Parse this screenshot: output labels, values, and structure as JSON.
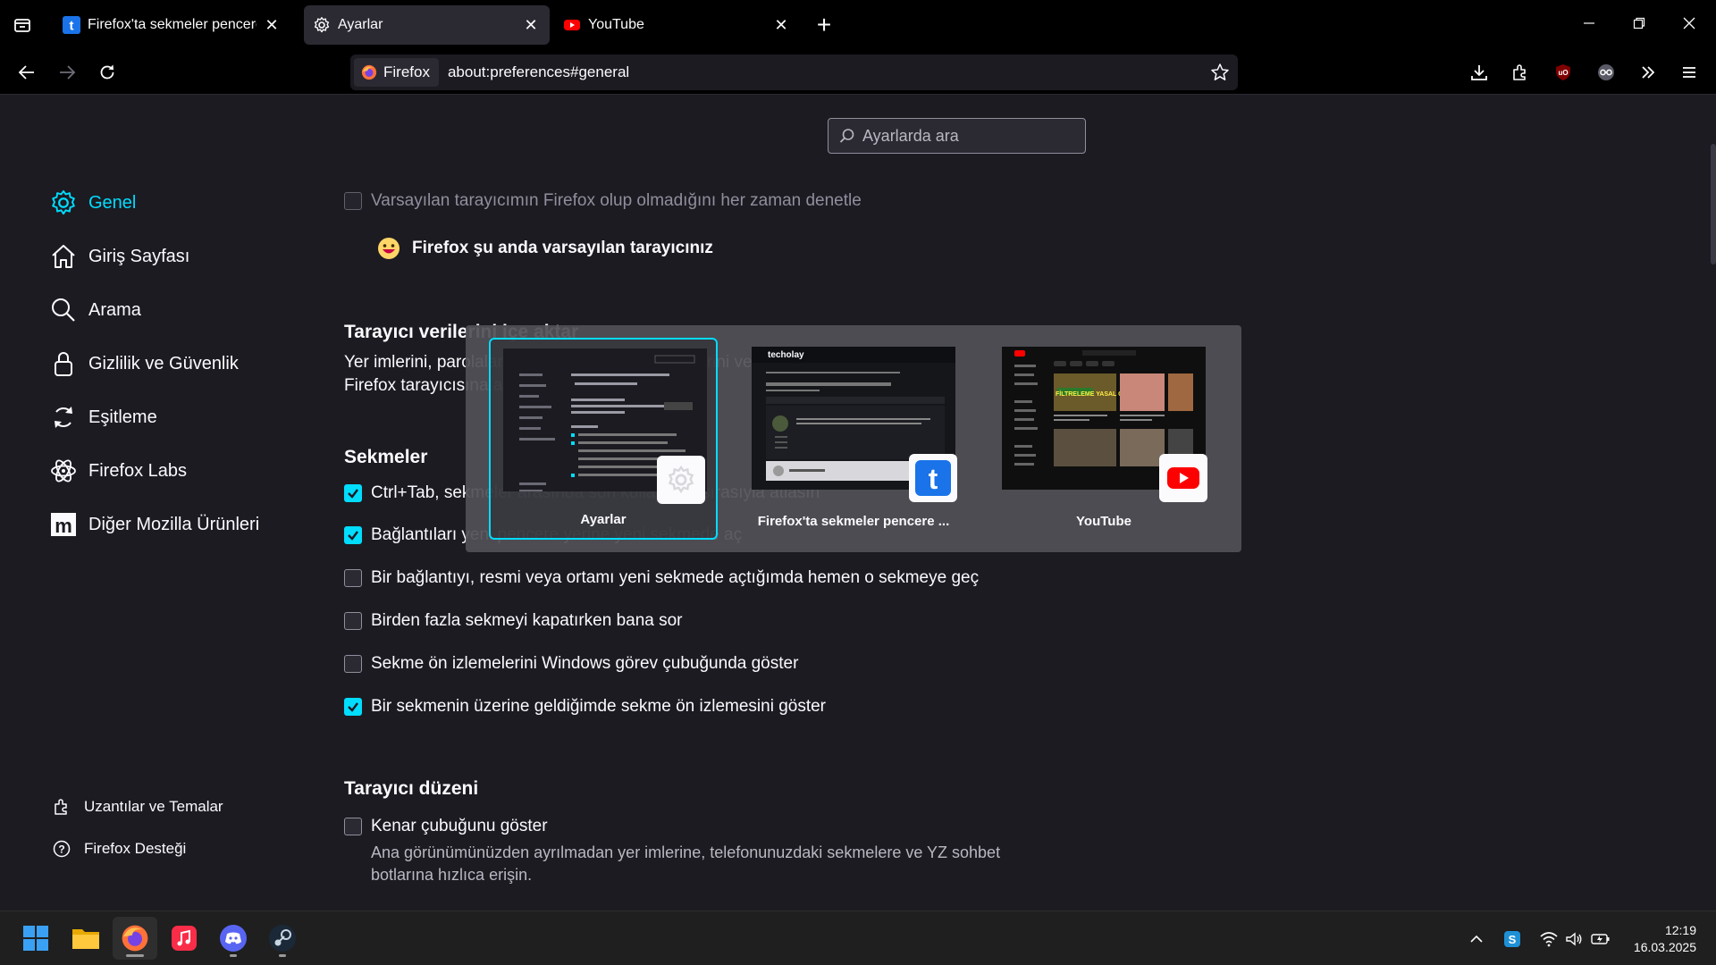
{
  "tabs": [
    {
      "title": "Firefox'ta sekmeler pencere olar",
      "active": false,
      "icon": "techolay-t-icon"
    },
    {
      "title": "Ayarlar",
      "active": true,
      "icon": "gear-icon"
    },
    {
      "title": "YouTube",
      "active": false,
      "icon": "youtube-icon"
    }
  ],
  "urlbar": {
    "identity_label": "Firefox",
    "url": "about:preferences#general"
  },
  "search": {
    "placeholder": "Ayarlarda ara"
  },
  "sidebar": {
    "categories": [
      {
        "label": "Genel",
        "selected": true
      },
      {
        "label": "Giriş Sayfası"
      },
      {
        "label": "Arama"
      },
      {
        "label": "Gizlilik ve Güvenlik"
      },
      {
        "label": "Eşitleme"
      },
      {
        "label": "Firefox Labs"
      },
      {
        "label": "Diğer Mozilla Ürünleri"
      }
    ],
    "footer": [
      {
        "label": "Uzantılar ve Temalar"
      },
      {
        "label": "Firefox Desteği"
      }
    ]
  },
  "general": {
    "default_check_label": "Varsayılan tarayıcımın Firefox olup olmadığını her zaman denetle",
    "default_status": "Firefox şu anda varsayılan tarayıcınız",
    "import_heading": "Tarayıcı verilerini içe aktar",
    "import_text_1": "Yer imlerini, parolaları, geçmişi, kredi kartı bilgilerini ve diğer verileri",
    "import_text_2": "Firefox tarayıcısına aktarın.",
    "tabs_heading": "Sekmeler",
    "tab_options": [
      {
        "label": "Ctrl+Tab, sekmeler arasında son kullanılma sırasıyla atlasın",
        "checked": true
      },
      {
        "label": "Bağlantıları yeni pencere yerine yeni sekmede aç",
        "checked": true
      },
      {
        "label": "Bir bağlantıyı, resmi veya ortamı yeni sekmede açtığımda hemen o sekmeye geç",
        "checked": false
      },
      {
        "label": "Birden fazla sekmeyi kapatırken bana sor",
        "checked": false
      },
      {
        "label": "Sekme ön izlemelerini Windows görev çubuğunda göster",
        "checked": false
      },
      {
        "label": "Bir sekmenin üzerine geldiğimde sekme ön izlemesini göster",
        "checked": true
      }
    ],
    "layout_heading": "Tarayıcı düzeni",
    "sidebar_option": {
      "label": "Kenar çubuğunu göster",
      "checked": false
    },
    "sidebar_desc": "Ana görünümünüzden ayrılmadan yer imlerine, telefonunuzdaki sekmelere ve YZ sohbet botlarına hızlıca erişin."
  },
  "ctrl_tab": {
    "previews": [
      {
        "title": "Ayarlar",
        "selected": true,
        "icon": "gear-icon"
      },
      {
        "title": "Firefox'ta sekmeler pencere ...",
        "selected": false,
        "icon": "techolay-t-icon"
      },
      {
        "title": "YouTube",
        "selected": false,
        "icon": "youtube-icon"
      }
    ],
    "thumb_texts": {
      "techolay_logo": "techolay",
      "yt_overlay": "FİLTRELEME YASAL OLMALI MI?"
    }
  },
  "taskbar": {
    "apps": [
      "windows-start-icon",
      "file-explorer-icon",
      "firefox-icon",
      "apple-music-icon",
      "discord-icon",
      "steam-icon"
    ],
    "time": "12:19",
    "date": "16.03.2025"
  },
  "colors": {
    "accent": "#00ddff",
    "bg": "#1c1b22",
    "toolbar": "#000000"
  }
}
